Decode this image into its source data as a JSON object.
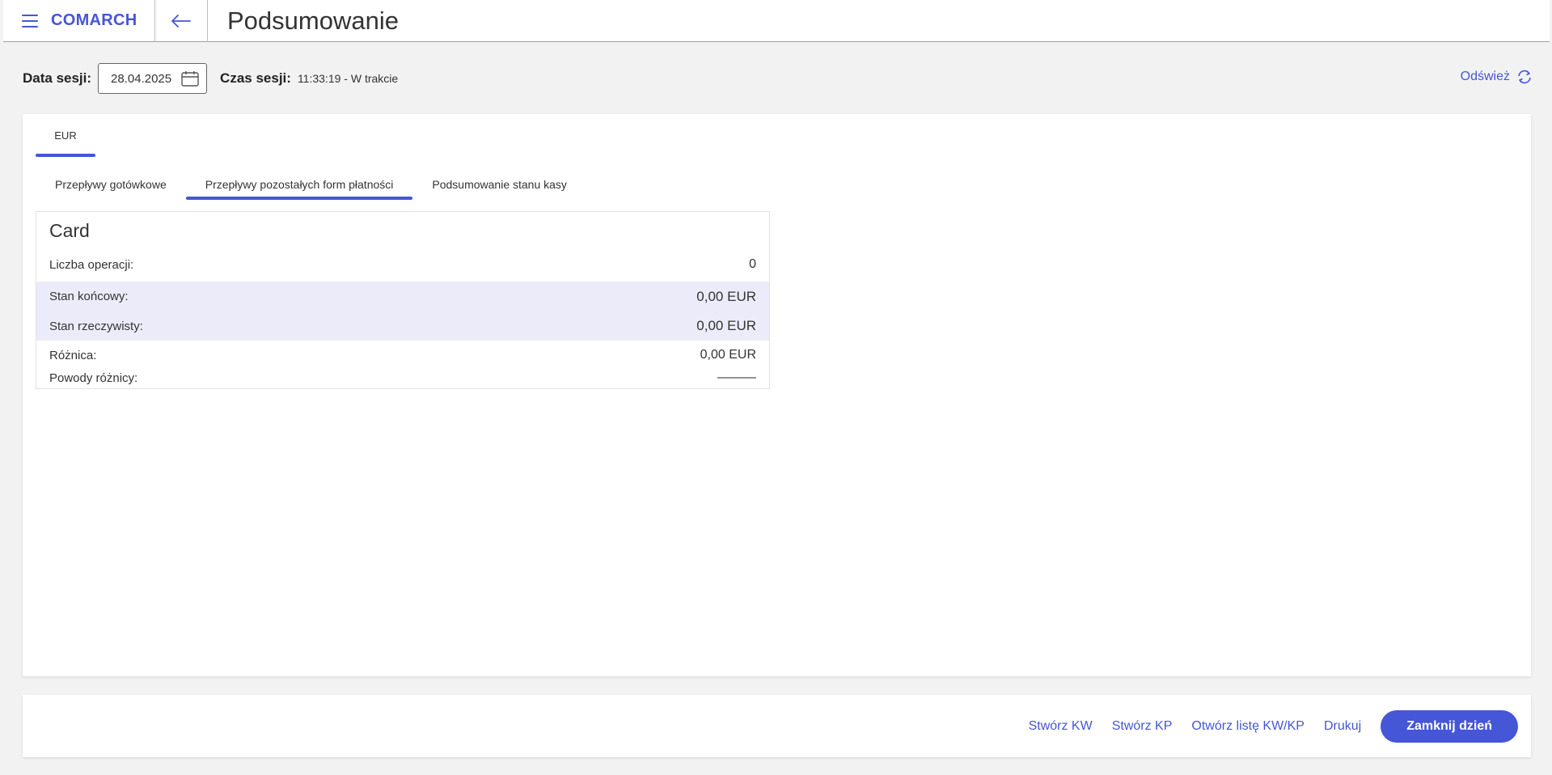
{
  "header": {
    "brand": "COMARCH",
    "title": "Podsumowanie",
    "menu_icon": "hamburger-icon",
    "back_icon": "arrow-left-icon"
  },
  "session": {
    "date_label": "Data sesji:",
    "date_value": "28.04.2025",
    "time_label": "Czas sesji:",
    "time_value": "11:33:19 - W trakcie",
    "refresh_label": "Odśwież"
  },
  "currency_tabs": [
    {
      "label": "EUR",
      "active": true
    }
  ],
  "tabs": [
    {
      "label": "Przepływy gotówkowe",
      "active": false
    },
    {
      "label": "Przepływy pozostałych form płatności",
      "active": true
    },
    {
      "label": "Podsumowanie stanu kasy",
      "active": false
    }
  ],
  "payment_card": {
    "title": "Card",
    "rows": [
      {
        "label": "Liczba operacji:",
        "value": "0"
      },
      {
        "label": "Stan końcowy:",
        "value": "0,00 EUR"
      },
      {
        "label": "Stan rzeczywisty:",
        "value": "0,00 EUR"
      },
      {
        "label": "Różnica:",
        "value": "0,00 EUR"
      },
      {
        "label": "Powody różnicy:",
        "value": "———"
      }
    ]
  },
  "footer": {
    "create_kw": "Stwórz KW",
    "create_kp": "Stwórz KP",
    "open_list": "Otwórz listę KW/KP",
    "print": "Drukuj",
    "close_day": "Zamknij dzień"
  },
  "colors": {
    "accent": "#4556d6",
    "highlight_row": "#ebebfa",
    "background": "#f2f2f2"
  }
}
